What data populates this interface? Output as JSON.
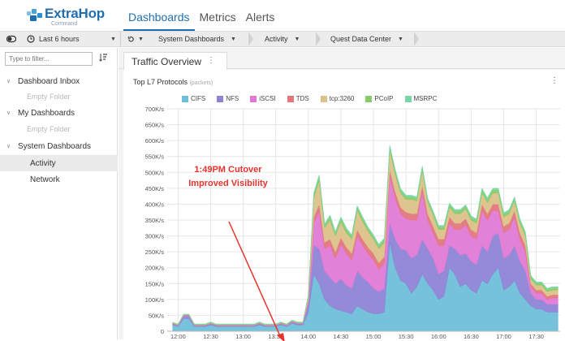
{
  "app": {
    "logo_name": "ExtraHop",
    "logo_sub": "Command",
    "nav_tabs": [
      "Dashboards",
      "Metrics",
      "Alerts"
    ]
  },
  "toolbar": {
    "time_range": "Last 6 hours",
    "breadcrumbs": [
      "System Dashboards",
      "Activity",
      "Quest Data Center"
    ]
  },
  "sidebar": {
    "filter_placeholder": "Type to filter...",
    "groups": [
      {
        "label": "Dashboard Inbox",
        "empty": "Empty Folder"
      },
      {
        "label": "My Dashboards",
        "empty": "Empty Folder"
      },
      {
        "label": "System Dashboards",
        "items": [
          "Activity",
          "Network"
        ]
      }
    ]
  },
  "page": {
    "tab_label": "Traffic Overview"
  },
  "panel": {
    "title": "Top L7 Protocols",
    "unit": "(packets)",
    "annotation_line1": "1:49PM Cutover",
    "annotation_line2": "Improved Visibility"
  },
  "colors": {
    "accent": "#1f6fb0",
    "annotation": "#e8322b",
    "CIFS": "#6fbfd9",
    "NFS": "#8d84d6",
    "iSCSI": "#e07ad6",
    "TDS": "#e2777d",
    "tcp3260": "#dcc28a",
    "PCoIP": "#88cc66",
    "MSRPC": "#7ad6a8"
  },
  "chart_data": {
    "type": "area",
    "stacked": true,
    "title": "Top L7 Protocols",
    "subtitle": "(packets)",
    "ylabel": "",
    "xlabel": "",
    "ylim": [
      0,
      700
    ],
    "y_unit": "K/s",
    "y_ticks": [
      "0",
      "50K/s",
      "100K/s",
      "150K/s",
      "200K/s",
      "250K/s",
      "300K/s",
      "350K/s",
      "400K/s",
      "450K/s",
      "500K/s",
      "550K/s",
      "600K/s",
      "650K/s",
      "700K/s"
    ],
    "x_ticks": [
      "12:00",
      "12:30",
      "13:00",
      "13:30",
      "14:00",
      "14:30",
      "15:00",
      "15:30",
      "16:00",
      "16:30",
      "17:00",
      "17:30"
    ],
    "x_minutes": [
      -5,
      0,
      5,
      10,
      15,
      20,
      25,
      30,
      35,
      40,
      45,
      50,
      55,
      60,
      65,
      70,
      75,
      80,
      85,
      90,
      95,
      100,
      105,
      110,
      115,
      120,
      125,
      130,
      135,
      140,
      145,
      150,
      155,
      160,
      165,
      170,
      175,
      180,
      185,
      190,
      195,
      200,
      205,
      210,
      215,
      220,
      225,
      230,
      235,
      240,
      245,
      250,
      255,
      260,
      265,
      270,
      275,
      280,
      285,
      290,
      295,
      300,
      305,
      310,
      315,
      320,
      325,
      330,
      335,
      340,
      345,
      350
    ],
    "x_reference": "12:00 = 0 minutes",
    "series": [
      {
        "name": "CIFS",
        "values": [
          20,
          15,
          40,
          40,
          15,
          15,
          15,
          20,
          15,
          15,
          15,
          15,
          15,
          15,
          15,
          15,
          20,
          15,
          15,
          15,
          20,
          15,
          25,
          20,
          20,
          60,
          180,
          150,
          100,
          80,
          70,
          65,
          60,
          55,
          80,
          70,
          60,
          55,
          55,
          60,
          280,
          200,
          160,
          150,
          120,
          140,
          180,
          150,
          130,
          100,
          110,
          200,
          180,
          140,
          150,
          130,
          120,
          160,
          150,
          180,
          200,
          130,
          140,
          160,
          120,
          100,
          80,
          70,
          70,
          60,
          60,
          60
        ]
      },
      {
        "name": "NFS",
        "values": [
          3,
          3,
          8,
          8,
          3,
          3,
          3,
          4,
          3,
          3,
          3,
          3,
          3,
          3,
          3,
          3,
          4,
          3,
          3,
          3,
          4,
          3,
          5,
          4,
          4,
          25,
          90,
          110,
          90,
          90,
          80,
          100,
          85,
          80,
          110,
          100,
          95,
          80,
          70,
          75,
          60,
          90,
          100,
          105,
          110,
          100,
          110,
          110,
          100,
          80,
          80,
          70,
          80,
          100,
          95,
          90,
          90,
          110,
          100,
          120,
          110,
          100,
          100,
          110,
          100,
          90,
          40,
          30,
          30,
          25,
          25,
          25
        ]
      },
      {
        "name": "iSCSI",
        "values": [
          1,
          1,
          2,
          2,
          1,
          1,
          1,
          1,
          1,
          1,
          1,
          1,
          1,
          1,
          1,
          1,
          1,
          1,
          1,
          1,
          1,
          1,
          1,
          1,
          1,
          10,
          70,
          120,
          70,
          100,
          80,
          110,
          100,
          90,
          110,
          100,
          90,
          90,
          70,
          80,
          150,
          130,
          110,
          100,
          120,
          110,
          150,
          90,
          80,
          90,
          80,
          70,
          60,
          80,
          90,
          80,
          80,
          110,
          100,
          80,
          70,
          80,
          80,
          90,
          70,
          60,
          20,
          20,
          20,
          15,
          20,
          20
        ]
      },
      {
        "name": "TDS",
        "values": [
          1,
          1,
          1,
          1,
          1,
          1,
          1,
          1,
          1,
          1,
          1,
          1,
          1,
          1,
          1,
          1,
          1,
          1,
          1,
          1,
          1,
          1,
          1,
          1,
          1,
          5,
          20,
          20,
          20,
          20,
          20,
          20,
          20,
          20,
          20,
          20,
          20,
          20,
          20,
          20,
          20,
          20,
          20,
          20,
          20,
          20,
          20,
          20,
          20,
          20,
          20,
          20,
          20,
          20,
          20,
          20,
          20,
          20,
          20,
          20,
          20,
          20,
          20,
          20,
          20,
          20,
          10,
          10,
          10,
          10,
          10,
          10
        ]
      },
      {
        "name": "tcp:3260",
        "values": [
          1,
          1,
          1,
          1,
          1,
          1,
          1,
          1,
          1,
          1,
          1,
          1,
          1,
          1,
          1,
          1,
          1,
          1,
          1,
          1,
          1,
          1,
          1,
          1,
          1,
          10,
          60,
          75,
          45,
          60,
          50,
          50,
          45,
          45,
          60,
          55,
          50,
          45,
          45,
          45,
          60,
          55,
          45,
          40,
          45,
          40,
          45,
          35,
          35,
          30,
          30,
          30,
          30,
          30,
          30,
          30,
          30,
          35,
          35,
          35,
          35,
          30,
          30,
          30,
          30,
          30,
          15,
          15,
          15,
          15,
          15,
          15
        ]
      },
      {
        "name": "PCoIP",
        "values": [
          1,
          1,
          1,
          1,
          1,
          1,
          1,
          1,
          1,
          1,
          1,
          1,
          1,
          1,
          1,
          1,
          1,
          1,
          1,
          1,
          1,
          1,
          1,
          1,
          1,
          2,
          10,
          12,
          8,
          10,
          8,
          10,
          10,
          8,
          10,
          10,
          8,
          8,
          8,
          8,
          10,
          10,
          8,
          8,
          8,
          8,
          10,
          8,
          8,
          8,
          8,
          8,
          8,
          8,
          8,
          8,
          8,
          10,
          10,
          10,
          10,
          8,
          8,
          8,
          8,
          8,
          6,
          6,
          6,
          6,
          6,
          6
        ]
      },
      {
        "name": "MSRPC",
        "values": [
          1,
          1,
          1,
          1,
          1,
          1,
          1,
          1,
          1,
          1,
          1,
          1,
          1,
          1,
          1,
          1,
          1,
          1,
          1,
          1,
          1,
          1,
          1,
          1,
          1,
          2,
          5,
          5,
          5,
          5,
          5,
          5,
          5,
          5,
          5,
          5,
          5,
          5,
          5,
          5,
          5,
          5,
          5,
          5,
          5,
          5,
          5,
          5,
          5,
          5,
          5,
          5,
          5,
          5,
          5,
          5,
          5,
          5,
          5,
          5,
          5,
          5,
          5,
          5,
          5,
          5,
          4,
          4,
          4,
          4,
          4,
          4
        ]
      }
    ]
  }
}
